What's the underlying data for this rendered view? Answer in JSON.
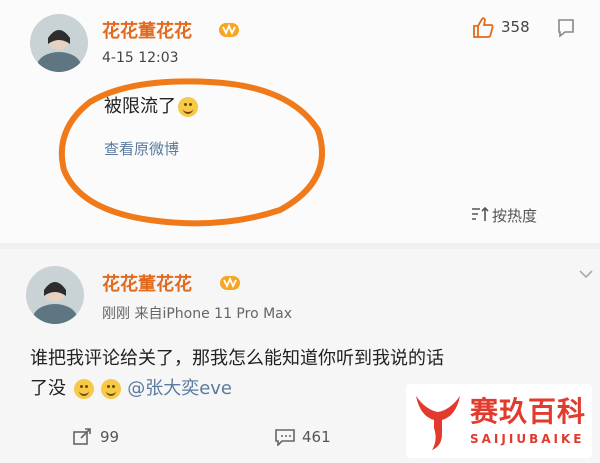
{
  "post": {
    "username": "花花董花花",
    "time": "4-15 12:03",
    "text": "被限流了",
    "view_original": "查看原微博",
    "like_count": "358",
    "sort_label": "按热度"
  },
  "comment": {
    "username": "花花董花花",
    "meta": "刚刚 来自iPhone 11 Pro Max",
    "text_line1": "谁把我评论给关了，那我怎么能知道你听到我说的话",
    "text_line2_prefix": "了没",
    "mention": "@张大奕eve",
    "repost_count": "99",
    "comment_count": "461"
  },
  "watermark": {
    "title": "赛玖百科",
    "subtitle": "SAIJIUBAIKE"
  },
  "colors": {
    "username": "#e26a1f",
    "highlight_circle": "#f07a1a",
    "link": "#5a7a9e",
    "watermark": "#e23b2e"
  }
}
